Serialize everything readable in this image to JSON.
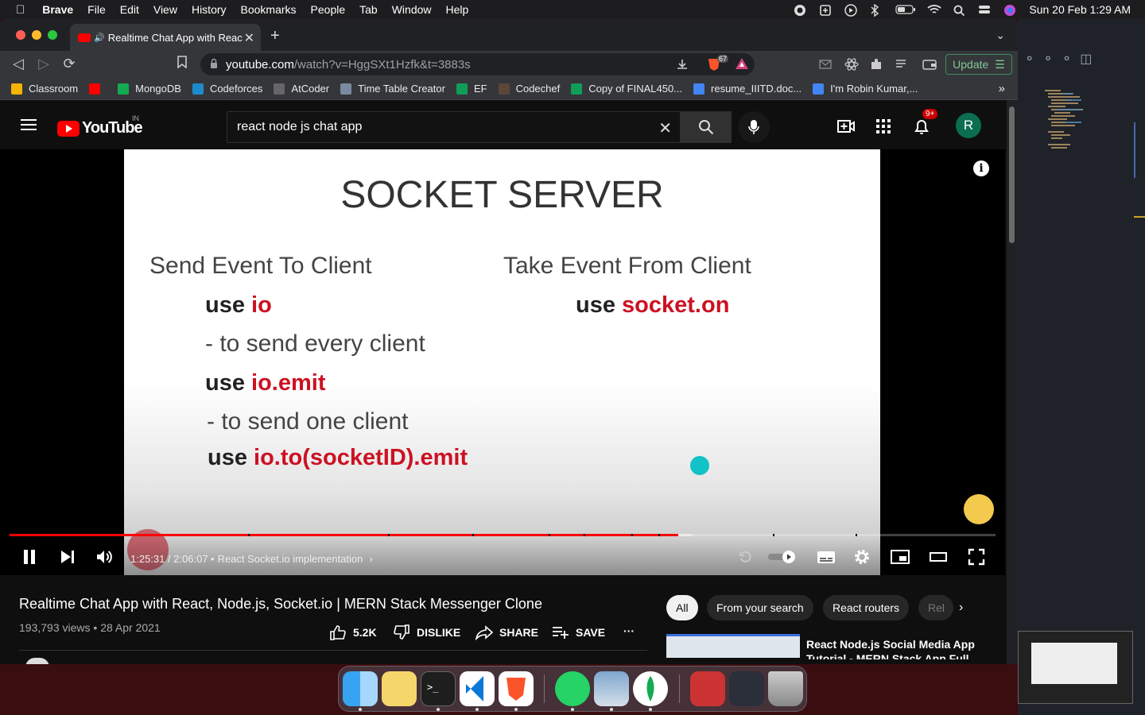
{
  "menubar": {
    "app": "Brave",
    "items": [
      "File",
      "Edit",
      "View",
      "History",
      "Bookmarks",
      "People",
      "Tab",
      "Window",
      "Help"
    ],
    "clock": "Sun 20 Feb  1:29 AM"
  },
  "browser": {
    "tab_title": "Realtime Chat App with Reac",
    "url_host": "youtube.com",
    "url_path": "/watch?v=HggSXt1Hzfk&t=3883s",
    "shields_count": "67",
    "update_label": "Update",
    "bookmarks": [
      {
        "label": "Classroom",
        "color": "#f4b400"
      },
      {
        "label": "",
        "color": "#ff0000"
      },
      {
        "label": "MongoDB",
        "color": "#13aa52"
      },
      {
        "label": "Codeforces",
        "color": "#1f8acb"
      },
      {
        "label": "AtCoder",
        "color": "#666666"
      },
      {
        "label": "Time Table Creator",
        "color": "#7a8aa0"
      },
      {
        "label": "EF",
        "color": "#0f9d58"
      },
      {
        "label": "Codechef",
        "color": "#5b4638"
      },
      {
        "label": "Copy of FINAL450...",
        "color": "#0f9d58"
      },
      {
        "label": "resume_IIITD.doc...",
        "color": "#4285f4"
      },
      {
        "label": "I'm Robin Kumar,...",
        "color": "#4285f4"
      }
    ]
  },
  "youtube": {
    "country": "IN",
    "search_value": "react node js chat app",
    "notification_count": "9+",
    "avatar_letter": "R",
    "slide": {
      "title": "SOCKET SERVER",
      "left_heading": "Send Event To Client",
      "use1_prefix": "use ",
      "use1_code": "io",
      "note1": "- to send every client",
      "use2_prefix": "use ",
      "use2_code": "io.emit",
      "note2": "- to send one client",
      "use3_prefix": "use ",
      "use3_code": "io.to(socketID).emit",
      "right_heading": "Take Event From Client",
      "use4_prefix": "use ",
      "use4_code": "socket.on"
    },
    "player": {
      "current_time": "1:25:31",
      "duration": "2:06:07",
      "time_separator": " / ",
      "chapter": "React Socket.io implementation",
      "played_fraction": 0.678,
      "buffered_fraction": 0.693,
      "chapter_marks_fraction": [
        0.242,
        0.384,
        0.469,
        0.547,
        0.582,
        0.631,
        0.658,
        0.774,
        0.858
      ]
    },
    "video": {
      "title": "Realtime Chat App with React, Node.js, Socket.io | MERN Stack Messenger Clone",
      "views": "193,793 views",
      "date": "28 Apr 2021",
      "meta_separator": " • ",
      "like_count": "5.2K",
      "dislike_label": "DISLIKE",
      "share_label": "SHARE",
      "save_label": "SAVE",
      "more_label": "···"
    },
    "chips": [
      "All",
      "From your search",
      "React routers",
      "Rel"
    ],
    "recommendation_title": "React Node.js Social Media App Tutorial - MERN Stack App Full"
  }
}
